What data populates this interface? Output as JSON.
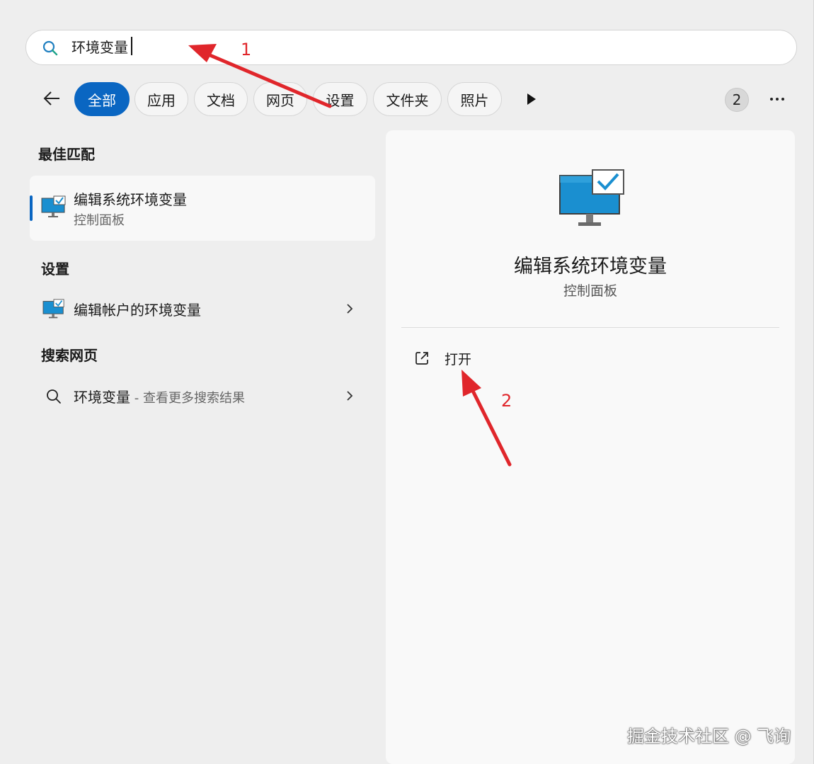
{
  "search": {
    "value": "环境变量",
    "icon": "search-icon"
  },
  "filters": {
    "back_icon": "arrow-left-icon",
    "chips": [
      {
        "label": "全部",
        "active": true
      },
      {
        "label": "应用",
        "active": false
      },
      {
        "label": "文档",
        "active": false
      },
      {
        "label": "网页",
        "active": false
      },
      {
        "label": "设置",
        "active": false
      },
      {
        "label": "文件夹",
        "active": false
      },
      {
        "label": "照片",
        "active": false
      }
    ],
    "play_icon": "play-icon",
    "count": "2",
    "more_icon": "more-ellipsis-icon"
  },
  "best_match": {
    "heading": "最佳匹配",
    "title": "编辑系统环境变量",
    "subtitle": "控制面板",
    "icon": "monitor-check-icon"
  },
  "settings": {
    "heading": "设置",
    "items": [
      {
        "label": "编辑帐户的环境变量",
        "icon": "monitor-check-icon"
      }
    ]
  },
  "web": {
    "heading": "搜索网页",
    "items": [
      {
        "label": "环境变量",
        "hint": " - 查看更多搜索结果",
        "icon": "search-icon"
      }
    ]
  },
  "detail": {
    "title": "编辑系统环境变量",
    "subtitle": "控制面板",
    "actions": [
      {
        "label": "打开",
        "icon": "open-external-icon"
      }
    ]
  },
  "annotations": {
    "label_1": "1",
    "label_2": "2",
    "color": "#e0262b"
  },
  "watermark": "掘金技术社区 @ 飞询",
  "colors": {
    "accent": "#0a66c2",
    "background": "#eeeeee",
    "panel": "#f9f9f9"
  }
}
